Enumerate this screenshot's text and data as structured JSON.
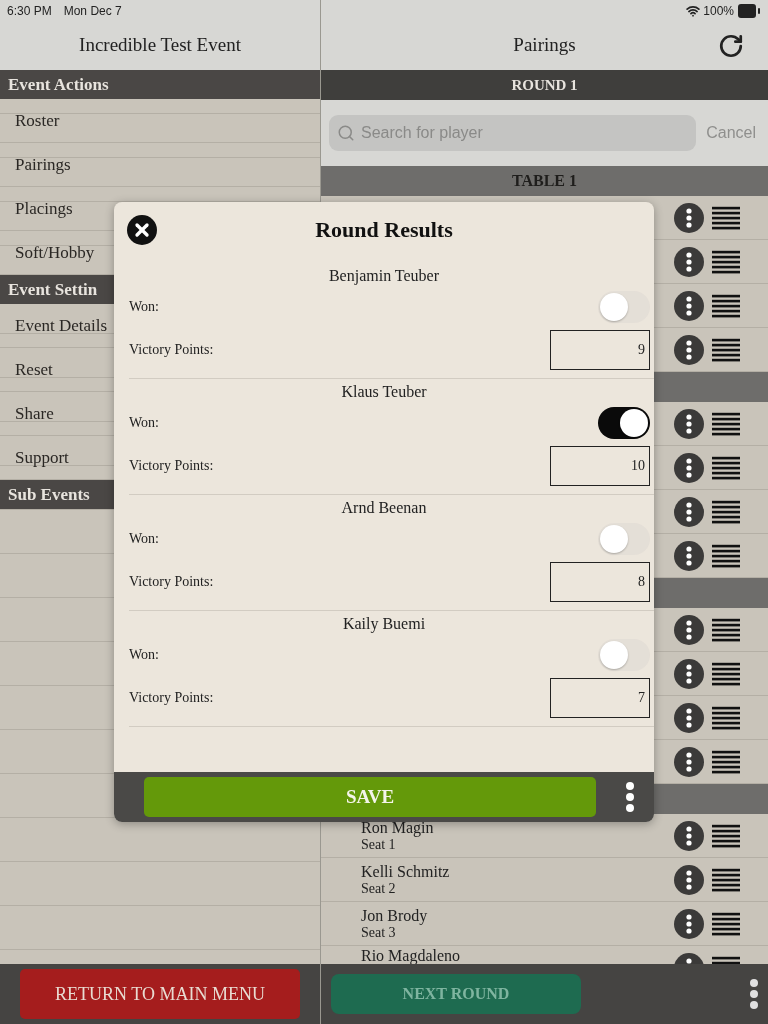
{
  "status_bar": {
    "time": "6:30 PM",
    "date": "Mon Dec 7",
    "battery": "100%"
  },
  "sidebar": {
    "title": "Incredible Test Event",
    "sections": [
      {
        "title": "Event Actions",
        "items": [
          "Roster",
          "Pairings",
          "Placings",
          "Soft/Hobby"
        ]
      },
      {
        "title": "Event Settin",
        "items": [
          "Event Details",
          "Reset",
          "Share",
          "Support"
        ]
      },
      {
        "title": "Sub Events"
      }
    ],
    "return_button": "RETURN TO MAIN MENU"
  },
  "pairings": {
    "title": "Pairings",
    "round": "ROUND 1",
    "search": {
      "placeholder": "Search for player"
    },
    "cancel": "Cancel",
    "groups": [
      {
        "title": "TABLE 1",
        "rows": [
          {
            "kind": "covered"
          },
          {
            "kind": "covered"
          },
          {
            "kind": "covered"
          },
          {
            "kind": "covered"
          }
        ]
      },
      {
        "rows": [
          {
            "kind": "covered"
          },
          {
            "kind": "covered"
          },
          {
            "kind": "covered"
          },
          {
            "kind": "covered"
          }
        ]
      },
      {
        "rows": [
          {
            "kind": "covered"
          },
          {
            "kind": "covered"
          },
          {
            "kind": "covered"
          },
          {
            "kind": "covered"
          }
        ]
      },
      {
        "rows": [
          {
            "kind": "player",
            "name": "Ron Magin",
            "seat": "Seat 1"
          },
          {
            "kind": "player",
            "name": "Kelli Schmitz",
            "seat": "Seat 2"
          },
          {
            "kind": "player",
            "name": "Jon Brody",
            "seat": "Seat 3"
          },
          {
            "kind": "player",
            "name": "Rio Magdaleno"
          }
        ]
      }
    ],
    "next_round": {
      "label": "NEXT ROUND",
      "disabled": true
    }
  },
  "dialog": {
    "title": "Round Results",
    "save": "SAVE",
    "players": [
      {
        "name": "Benjamin Teuber",
        "won_label": "Won:",
        "won": false,
        "points_label": "Victory Points:",
        "points": "9"
      },
      {
        "name": "Klaus Teuber",
        "won_label": "Won:",
        "won": true,
        "points_label": "Victory Points:",
        "points": "10"
      },
      {
        "name": "Arnd Beenan",
        "won_label": "Won:",
        "won": false,
        "points_label": "Victory Points:",
        "points": "8"
      },
      {
        "name": "Kaily Buemi",
        "won_label": "Won:",
        "won": false,
        "points_label": "Victory Points:",
        "points": "7"
      }
    ]
  }
}
